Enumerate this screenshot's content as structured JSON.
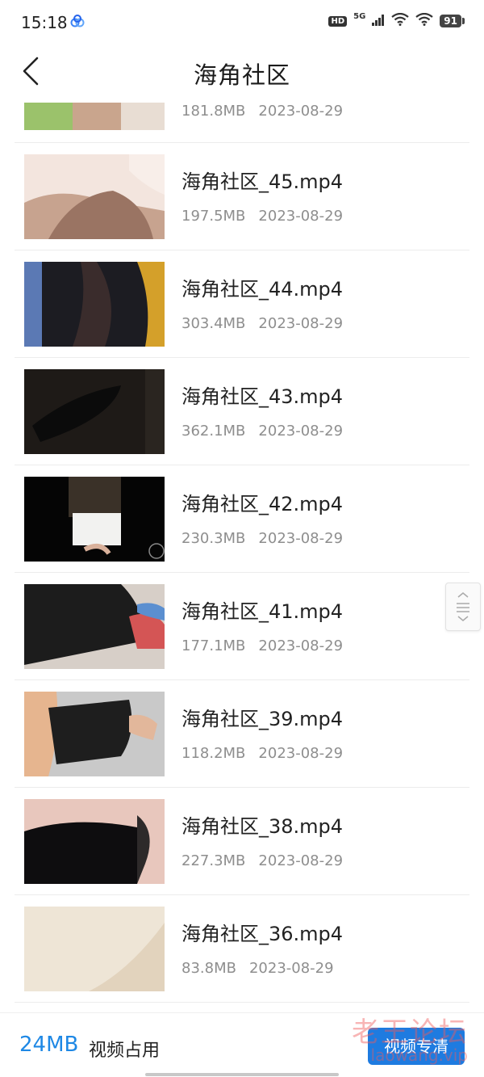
{
  "status_bar": {
    "time": "15:18",
    "app_icon": "cloud-link-icon",
    "hd": "HD",
    "network": "5G",
    "signal_icon": "signal-bars-icon",
    "wifi_icons": [
      "wifi-icon",
      "wifi-icon"
    ],
    "battery": "91"
  },
  "header": {
    "back_icon": "chevron-left-icon",
    "title": "海角社区"
  },
  "videos": [
    {
      "title": "",
      "size": "181.8MB",
      "date": "2023-08-29"
    },
    {
      "title": "海角社区_45.mp4",
      "size": "197.5MB",
      "date": "2023-08-29"
    },
    {
      "title": "海角社区_44.mp4",
      "size": "303.4MB",
      "date": "2023-08-29"
    },
    {
      "title": "海角社区_43.mp4",
      "size": "362.1MB",
      "date": "2023-08-29"
    },
    {
      "title": "海角社区_42.mp4",
      "size": "230.3MB",
      "date": "2023-08-29"
    },
    {
      "title": "海角社区_41.mp4",
      "size": "177.1MB",
      "date": "2023-08-29"
    },
    {
      "title": "海角社区_39.mp4",
      "size": "118.2MB",
      "date": "2023-08-29"
    },
    {
      "title": "海角社区_38.mp4",
      "size": "227.3MB",
      "date": "2023-08-29"
    },
    {
      "title": "海角社区_36.mp4",
      "size": "83.8MB",
      "date": "2023-08-29"
    }
  ],
  "scroll_handle_icon": "fast-scroll-handle-icon",
  "bottom_bar": {
    "usage_value": "24MB",
    "usage_label": "视频占用",
    "hd_button_label": "视频专清"
  },
  "watermark": {
    "text": "老王论坛",
    "url": "laowang.vip"
  },
  "colors": {
    "accent": "#1e88e5",
    "button": "#1e7be0",
    "meta_text": "#8e8e8e",
    "divider": "#ececec"
  }
}
